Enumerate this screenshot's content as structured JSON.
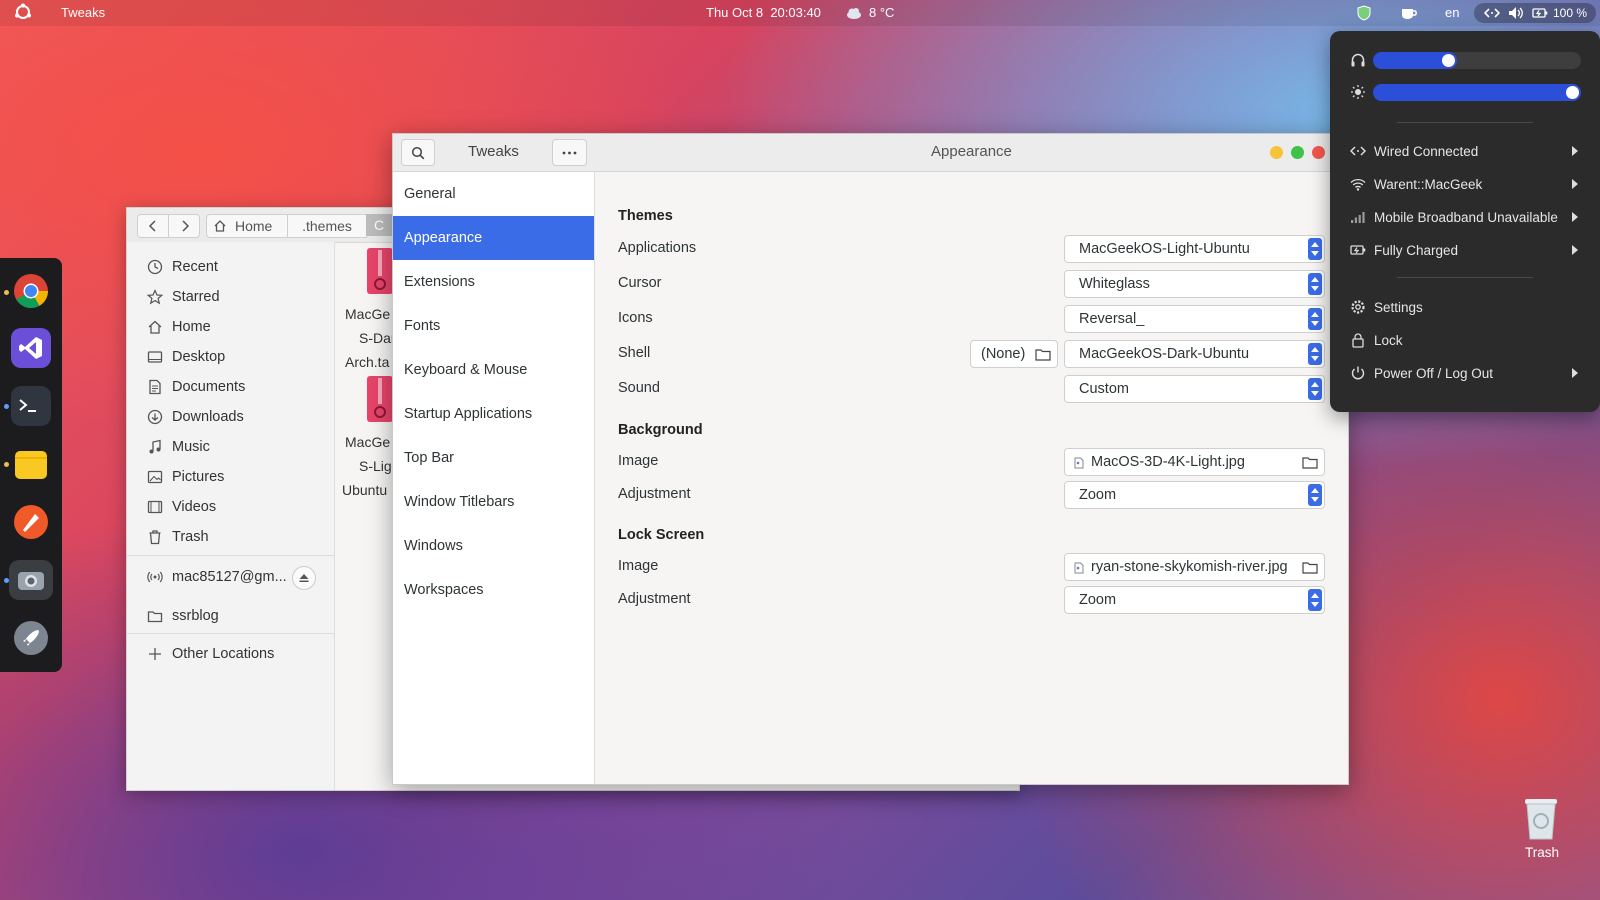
{
  "topbar": {
    "app_name": "Tweaks",
    "date": "Thu Oct 8",
    "time": "20:03:40",
    "weather": "8 °C",
    "lang": "en",
    "battery": "100 %"
  },
  "dock": {
    "apps": [
      {
        "name": "chrome"
      },
      {
        "name": "visual-studio-code"
      },
      {
        "name": "terminal"
      },
      {
        "name": "files"
      },
      {
        "name": "inkscape"
      },
      {
        "name": "screenshot"
      },
      {
        "name": "launchpad"
      }
    ]
  },
  "files_window": {
    "path": [
      "Home",
      ".themes",
      "C"
    ],
    "sidebar": [
      {
        "label": "Recent",
        "icon": "clock-icon"
      },
      {
        "label": "Starred",
        "icon": "star-icon"
      },
      {
        "label": "Home",
        "icon": "home-icon"
      },
      {
        "label": "Desktop",
        "icon": "desktop-icon"
      },
      {
        "label": "Documents",
        "icon": "document-icon"
      },
      {
        "label": "Downloads",
        "icon": "download-icon"
      },
      {
        "label": "Music",
        "icon": "music-icon"
      },
      {
        "label": "Pictures",
        "icon": "picture-icon"
      },
      {
        "label": "Videos",
        "icon": "video-icon"
      },
      {
        "label": "Trash",
        "icon": "trash-icon"
      },
      {
        "label": "mac85127@gm...",
        "icon": "network-icon"
      },
      {
        "label": "ssrblog",
        "icon": "folder-icon"
      },
      {
        "label": "Other Locations",
        "icon": "plus-icon"
      }
    ],
    "files": [
      {
        "lines": [
          "MacGe",
          "S-Dar",
          "Arch.ta"
        ]
      },
      {
        "lines": [
          "MacGe",
          "S-Lig",
          "Ubuntu"
        ]
      }
    ]
  },
  "tweaks": {
    "title": "Tweaks",
    "page_title": "Appearance",
    "categories": [
      "General",
      "Appearance",
      "Extensions",
      "Fonts",
      "Keyboard & Mouse",
      "Startup Applications",
      "Top Bar",
      "Window Titlebars",
      "Windows",
      "Workspaces"
    ],
    "active_category": "Appearance",
    "themes": {
      "heading": "Themes",
      "applications_label": "Applications",
      "applications_value": "MacGeekOS-Light-Ubuntu",
      "cursor_label": "Cursor",
      "cursor_value": "Whiteglass",
      "icons_label": "Icons",
      "icons_value": "Reversal_",
      "shell_label": "Shell",
      "shell_file": "(None)",
      "shell_value": "MacGeekOS-Dark-Ubuntu",
      "sound_label": "Sound",
      "sound_value": "Custom"
    },
    "background": {
      "heading": "Background",
      "image_label": "Image",
      "image_value": "MacOS-3D-4K-Light.jpg",
      "adjustment_label": "Adjustment",
      "adjustment_value": "Zoom"
    },
    "lock_screen": {
      "heading": "Lock Screen",
      "image_label": "Image",
      "image_value": "ryan-stone-skykomish-river.jpg",
      "adjustment_label": "Adjustment",
      "adjustment_value": "Zoom"
    }
  },
  "system_menu": {
    "volume_level": 0.35,
    "brightness_level": 1.0,
    "network": [
      {
        "label": "Wired Connected",
        "icon": "wired-icon"
      },
      {
        "label": "Warent::MacGeek",
        "icon": "wifi-icon"
      },
      {
        "label": "Mobile Broadband Unavailable",
        "icon": "signal-icon"
      },
      {
        "label": "Fully Charged",
        "icon": "battery-icon"
      }
    ],
    "actions": [
      {
        "label": "Settings",
        "icon": "gear-icon"
      },
      {
        "label": "Lock",
        "icon": "lock-icon"
      },
      {
        "label": "Power Off / Log Out",
        "icon": "power-icon"
      }
    ]
  },
  "desktop": {
    "trash_label": "Trash"
  },
  "colors": {
    "accent": "#3a6ce8",
    "menu_bg": "#2b2b2b"
  }
}
